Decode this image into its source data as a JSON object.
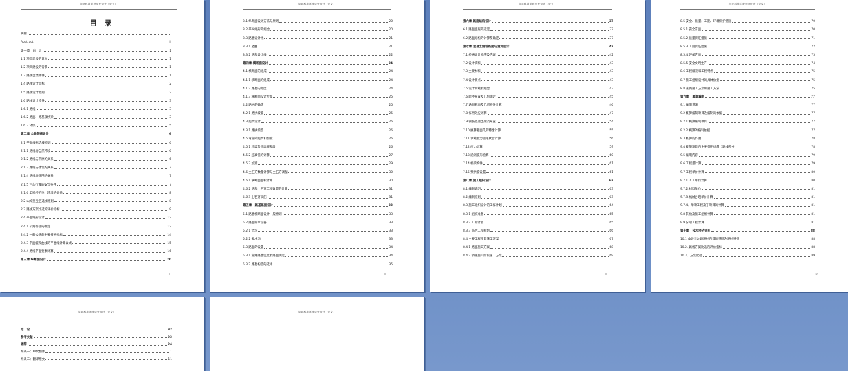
{
  "header_text": "华北科技学院毕业设计（论文）",
  "toc_title": "目 录",
  "pages": [
    {
      "page_number": "I",
      "entries": [
        {
          "t": "摘要",
          "n": "I"
        },
        {
          "t": "Abstract",
          "n": "II"
        },
        {
          "t": "第一章　前　言",
          "n": "1"
        },
        {
          "t": "1.1 项目建设的意义",
          "n": "1"
        },
        {
          "t": "1.2 项目建设的背景",
          "n": "1"
        },
        {
          "t": "1.3 路线自然条件",
          "n": "1"
        },
        {
          "t": "1.4 路线设计目标",
          "n": "2"
        },
        {
          "t": "1.5 路线设计原则",
          "n": "2"
        },
        {
          "t": "1.6 路线设计指导",
          "n": "3"
        },
        {
          "t": "1.6.1 路线",
          "n": "3"
        },
        {
          "t": "1.6.2 路面、路基及桥梁",
          "n": "3"
        },
        {
          "t": "1.6.3 环保",
          "n": "5"
        },
        {
          "t": "第二章 公路等级设计",
          "n": "6",
          "bold": true
        },
        {
          "t": "2.1 平面线形选线原则",
          "n": "6"
        },
        {
          "t": "2.1.1 路线与自然环境",
          "n": "6"
        },
        {
          "t": "2.1.2 路线与平原的关系",
          "n": "6"
        },
        {
          "t": "2.1.3 路线与建筑的关系",
          "n": "7"
        },
        {
          "t": "2.1.4 路线与农田的关系",
          "n": "7"
        },
        {
          "t": "2.1.5 汽车行驶的安全条件",
          "n": "7"
        },
        {
          "t": "2.1.6 工程经济性、环境的关系",
          "n": "8"
        },
        {
          "t": "2.2 山岭重丘区选线原则",
          "n": "8"
        },
        {
          "t": "2.3 路线方案比选的评价指标",
          "n": "9"
        },
        {
          "t": "2.4 平面线形设计",
          "n": "12"
        },
        {
          "t": "2.4.1 公路等级的确定",
          "n": "12"
        },
        {
          "t": "2.4.2 一般公路的主要技术指标",
          "n": "14"
        },
        {
          "t": "2.4.3 平面缓和曲线的平曲线计算公式",
          "n": "15"
        },
        {
          "t": "2.4.4 路线平面要素计算",
          "n": "16"
        },
        {
          "t": "第三章 纵断面设计",
          "n": "20",
          "bold": true
        }
      ]
    },
    {
      "page_number": "II",
      "entries": [
        {
          "t": "3.1 纵断面设计方法与原则",
          "n": "20"
        },
        {
          "t": "3.2 平纵线形的组合",
          "n": "20"
        },
        {
          "t": "3.3 路基设计线",
          "n": "21"
        },
        {
          "t": "3.3.1 竖曲",
          "n": "21"
        },
        {
          "t": "3.3.2 路基设计线",
          "n": "22"
        },
        {
          "t": "第四章 横断面设计",
          "n": "24",
          "bold": true
        },
        {
          "t": "4.1 横断面的组成",
          "n": "24"
        },
        {
          "t": "4.1.1 横断面的组成",
          "n": "24"
        },
        {
          "t": "4.1.2 路基的宽度",
          "n": "24"
        },
        {
          "t": "4.1.3 横断面设计步骤",
          "n": "25"
        },
        {
          "t": "4.2 路拱的确定",
          "n": "25"
        },
        {
          "t": "4.2.1 路拱坡度",
          "n": "25"
        },
        {
          "t": "4.3 超高设计",
          "n": "26"
        },
        {
          "t": "4.3.1 路拱坡度",
          "n": "26"
        },
        {
          "t": "4.5 弯道的超高和加宽",
          "n": "26"
        },
        {
          "t": "4.5.1 超高及超高缓和段",
          "n": "26"
        },
        {
          "t": "4.5.2 超高值的计算",
          "n": "27"
        },
        {
          "t": "4.5.3 加宽",
          "n": "29"
        },
        {
          "t": "4.6 土石方数量计算与土石方调配",
          "n": "30"
        },
        {
          "t": "4.6.1 横断面面积计算",
          "n": "30"
        },
        {
          "t": "4.6.2 路基土石方工程数量的计算",
          "n": "31"
        },
        {
          "t": "4.6.3 土石方调配",
          "n": "31"
        },
        {
          "t": "第五章　路基路面设计",
          "n": "33",
          "bold": true
        },
        {
          "t": "5.1 路基横断面设计一般原则",
          "n": "33"
        },
        {
          "t": "5.2 路面排水设备",
          "n": "33"
        },
        {
          "t": "5.2.1 边沟",
          "n": "33"
        },
        {
          "t": "5.2.2 截水沟",
          "n": "33"
        },
        {
          "t": "5.3 路面的设置",
          "n": "34"
        },
        {
          "t": "5.3.1 道路路基佳度及路面确定",
          "n": "34"
        },
        {
          "t": "5.3.2 路基构造的选择",
          "n": "35"
        }
      ]
    },
    {
      "page_number": "III",
      "entries": [
        {
          "t": "第六章 路面结构设计",
          "n": "37",
          "bold": true
        },
        {
          "t": "6.1 路面面层的选定",
          "n": "37"
        },
        {
          "t": "6.2 路面结构的计算及确定",
          "n": "37"
        },
        {
          "t": "第七章 混凝土刚性路面与涵洞设计",
          "n": "42",
          "bold": true
        },
        {
          "t": "7.1 桥涵设计程序及内容",
          "n": "42"
        },
        {
          "t": "7.2 设计资料",
          "n": "43"
        },
        {
          "t": "7.3 主要材料",
          "n": "43"
        },
        {
          "t": "7.4 设计要点",
          "n": "43"
        },
        {
          "t": "7.5 设计荷载及组合",
          "n": "43"
        },
        {
          "t": "7.6 跨径布置及几何确定",
          "n": "45"
        },
        {
          "t": "7.7 涵洞截面及几何特性计算",
          "n": "46"
        },
        {
          "t": "7.8 作用效应计算",
          "n": "47"
        },
        {
          "t": "7.9 钢筋混凝土梁及布置",
          "n": "54"
        },
        {
          "t": "7.10 换算截面几何特性计算",
          "n": "55"
        },
        {
          "t": "7.11 承载能力极限状态计算",
          "n": "56"
        },
        {
          "t": "7.12 应力计算",
          "n": "59"
        },
        {
          "t": "7.13 涵洞变形验算",
          "n": "60"
        },
        {
          "t": "7.14 桥梁构件",
          "n": "61"
        },
        {
          "t": "7.15 预拱度设置",
          "n": "61"
        },
        {
          "t": "第八章 施工组织设计",
          "n": "63",
          "bold": true
        },
        {
          "t": "8.1 编制说明",
          "n": "63"
        },
        {
          "t": "8.2 编制原则",
          "n": "63"
        },
        {
          "t": "8.3 施工组织设计的工作计划",
          "n": "64"
        },
        {
          "t": "8.3.1 组织准备",
          "n": "65"
        },
        {
          "t": "8.3.2 工期计划",
          "n": "65"
        },
        {
          "t": "8.3.3 临时工程规划",
          "n": "66"
        },
        {
          "t": "8.4 主要工程项目施工方案",
          "n": "67"
        },
        {
          "t": "8.4.1 路面施工方案",
          "n": "68"
        },
        {
          "t": "8.4.2 桥涵施工阶段施工方案",
          "n": "69"
        }
      ]
    },
    {
      "page_number": "IV",
      "entries": [
        {
          "t": "8.5 安全、质量、工期、环境保护措施",
          "n": "70"
        },
        {
          "t": "8.5.1 安全方面",
          "n": "70"
        },
        {
          "t": "8.5.2 质量保证措施",
          "n": "71"
        },
        {
          "t": "8.5.3 工期保证措施",
          "n": "72"
        },
        {
          "t": "8.5.4 环保方面",
          "n": "73"
        },
        {
          "t": "8.5.5 安全文明生产",
          "n": "74"
        },
        {
          "t": "8.6 工程概况和工程特点",
          "n": "75"
        },
        {
          "t": "8.7 施工组织设计的具体依据",
          "n": "75"
        },
        {
          "t": "8.8 道路施工方案和施工方法",
          "n": "75"
        },
        {
          "t": "第九章　概算编制",
          "n": "77",
          "bold": true
        },
        {
          "t": "9.1 编制说明",
          "n": "77"
        },
        {
          "t": "9.2 概算编制项目及编制的依据",
          "n": "77"
        },
        {
          "t": "9.2.1 概算编制项目",
          "n": "77"
        },
        {
          "t": "9.2.2 概算的编制依据",
          "n": "77"
        },
        {
          "t": "9.3 概算的作用",
          "n": "78"
        },
        {
          "t": "9.4 概算项目的主要费用组成（路线部分）",
          "n": "78"
        },
        {
          "t": "9.5 编制内容",
          "n": "79"
        },
        {
          "t": "9.6 工程量计算",
          "n": "79"
        },
        {
          "t": "9.7 工程单价计算",
          "n": "80"
        },
        {
          "t": "9.7.1 人工单价计算",
          "n": "80"
        },
        {
          "t": "9.7.2 材料单价",
          "n": "81"
        },
        {
          "t": "9.7.3 机械台班单价计算",
          "n": "81"
        },
        {
          "t": "9.7.4、单项工程及子项目的计算",
          "n": "81"
        },
        {
          "t": "9.8 其他及施工组织计算",
          "n": "81"
        },
        {
          "t": "9.9 分项工程计算",
          "n": "81"
        },
        {
          "t": "第十章　技术经济分析",
          "n": "88",
          "bold": true
        },
        {
          "t": "10.1 本设计公路路线的目的特征及路线特征",
          "n": "88"
        },
        {
          "t": "10.2. 路线方案比选的评价指标",
          "n": "88"
        },
        {
          "t": "10.3、方案比选",
          "n": "89"
        }
      ]
    }
  ],
  "bottom_pages": [
    {
      "entries": [
        {
          "t": "结　论",
          "n": "92",
          "bold": true
        },
        {
          "t": "参考文献",
          "n": "93",
          "bold": true
        },
        {
          "t": "谢辞",
          "n": "94",
          "bold": true
        },
        {
          "t": "附录一：中文翻译",
          "n": "1"
        },
        {
          "t": "附录二：翻译原文",
          "n": "11"
        }
      ]
    },
    {
      "entries": []
    }
  ]
}
